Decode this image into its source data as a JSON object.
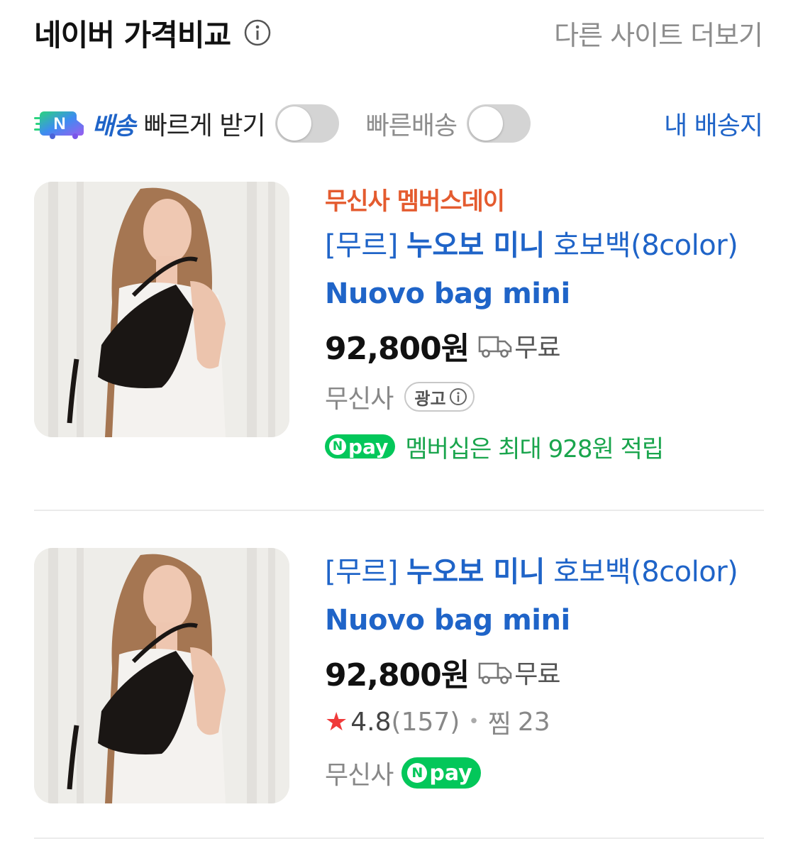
{
  "header": {
    "title": "네이버 가격비교",
    "more_link": "다른 사이트 더보기"
  },
  "filters": {
    "ndelivery_badge": "N",
    "ndelivery_label": "배송",
    "fast_receive_label": "빠르게 받기",
    "fast_receive_toggle": false,
    "fast_shipping_label": "빠른배송",
    "fast_shipping_toggle": false,
    "my_address_link": "내 배송지"
  },
  "products": [
    {
      "promo": "무신사 멤버스데이",
      "title_plain_1": "[무르] ",
      "title_bold_1": "누오보 미니",
      "title_plain_2": " 호보백(8color) ",
      "title_bold_2": "Nuovo bag mini",
      "price": "92,800원",
      "shipping": "무료",
      "mall": "무신사",
      "ad_label": "광고",
      "npay_label": "pay",
      "npay_benefit": "멤버십은 최대 928원 적립"
    },
    {
      "title_plain_1": "[무르] ",
      "title_bold_1": "누오보 미니",
      "title_plain_2": " 호보백(8color) ",
      "title_bold_2": "Nuovo bag mini",
      "price": "92,800원",
      "shipping": "무료",
      "rating": "4.8",
      "review_count": "(157)",
      "zzim_label": "찜",
      "zzim_count": "23",
      "mall": "무신사",
      "npay_label": "pay"
    }
  ],
  "colors": {
    "link_blue": "#1f64c8",
    "promo_orange": "#e45b2f",
    "npay_green": "#03c75a",
    "star_red": "#f03a3a"
  }
}
